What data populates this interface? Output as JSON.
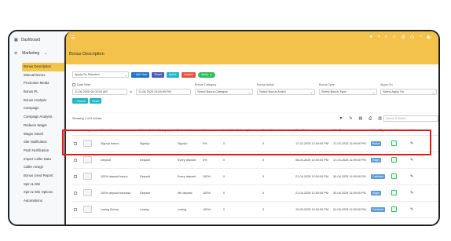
{
  "sidebar": {
    "dashboard": "Dashboard",
    "marketing": "Marketing",
    "items": [
      {
        "label": "Bonus Description",
        "active": true
      },
      {
        "label": "Manual Bonus"
      },
      {
        "label": "Promotion Media"
      },
      {
        "label": "Bonus PL"
      },
      {
        "label": "Bonus Analysis"
      },
      {
        "label": "Campaign"
      },
      {
        "label": "Campaign Analysis"
      },
      {
        "label": "Redeem Wager"
      },
      {
        "label": "Wager Detail"
      },
      {
        "label": "Site Notification"
      },
      {
        "label": "Push Notification"
      },
      {
        "label": "Import Caller Data"
      },
      {
        "label": "Caller Assign"
      },
      {
        "label": "Bonus Used Report"
      },
      {
        "label": "Spin & Win"
      },
      {
        "label": "Spin & Win Options"
      },
      {
        "label": "Automations"
      }
    ]
  },
  "page": {
    "title": "Bonus Description"
  },
  "toolbar": {
    "apply_on_selected": "Apply On Selected",
    "add_new": "+ Add New",
    "reset": "Reset",
    "active": "Active",
    "inactive": "Inactive",
    "active_toggle": "Active"
  },
  "filters": {
    "date_wise_label": "Date Wise",
    "start_date": "11-06-2025 00:00:00 AM",
    "to": "to",
    "end_date": "11-06-2025 23:59:59 PM",
    "bonus_category_label": "Bonus Category",
    "bonus_category_placeholder": "Select Bonus Category",
    "bonus_action_label": "Bonus Action",
    "bonus_action_placeholder": "Select Bonus Action",
    "bonus_type_label": "Bonus Type",
    "bonus_type_placeholder": "Select Bonus Type",
    "apply_on_label": "Apply On",
    "apply_on_placeholder": "Select Apply On",
    "search": "Search",
    "reset": "Reset"
  },
  "table": {
    "showing": "Showing 1 of 5 entries",
    "search_placeholder": "Search 5 Entries",
    "columns": [
      "Image",
      "Bonus Name",
      "Bonus Action Category",
      "Bonus Action",
      "Bonus",
      "User Max Subscriptions",
      "Total Subscribed",
      "Start Date",
      "End Date",
      "Wallet Type",
      "Is Active",
      "Action"
    ],
    "rows": [
      {
        "name": "Signup bonus",
        "category": "SignUp",
        "action": "SignUp",
        "bonus": "0%",
        "max": "0",
        "total": "0",
        "start": "17-02-2025 12:00:00 PM",
        "end": "17-02-2025 11:59:00 PM",
        "wallet": "Bonus",
        "wallet_color": "#5b9bd5"
      },
      {
        "name": "Deposit",
        "category": "Deposit",
        "action": "Every deposit",
        "bonus": "0%",
        "max": "0",
        "total": "0",
        "start": "08-04-2025 12:00:00 PM",
        "end": "17-04-2025 11:59:00 PM",
        "wallet": "Wager",
        "wallet_color": "#5b9bd5"
      },
      {
        "name": "100% deposit bonus",
        "category": "Deposit",
        "action": "Every deposit",
        "bonus": "100%",
        "max": "0",
        "total": "0",
        "start": "21-04-2025 12:00:00 PM",
        "end": "30-04-2025 11:59:00 PM",
        "wallet": "Cashback",
        "wallet_color": "#5b9bd5"
      },
      {
        "name": "100% deposit bonusss",
        "category": "Deposit",
        "action": "4th deposit",
        "bonus": "100%",
        "max": "0",
        "total": "0",
        "start": "21-04-2025 12:00:00 PM",
        "end": "30-04-2025 11:59:00 PM",
        "wallet": "Wager",
        "wallet_color": "#5b9bd5"
      },
      {
        "name": "Losing Bonus",
        "category": "Losing",
        "action": "Losing",
        "bonus": "100%",
        "max": "0",
        "total": "0",
        "start": "15-05-2025 12:00:00 PM",
        "end": "24-05-2025 11:59:00 PM",
        "wallet": "Cashback",
        "wallet_color": "#5b9bd5"
      }
    ]
  },
  "colors": {
    "accent": "#f2c24a",
    "highlight": "#e0191d"
  }
}
